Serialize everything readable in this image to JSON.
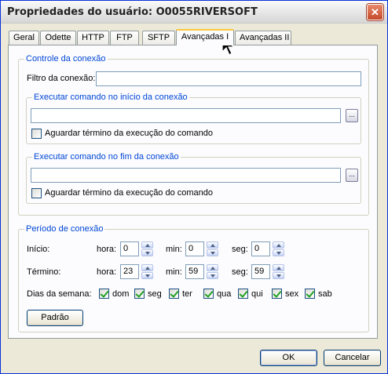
{
  "window": {
    "title": "Propriedades do usuário: O0055RIVERSOFT",
    "close_label": "✕"
  },
  "tabs": [
    {
      "label": "Geral"
    },
    {
      "label": "Odette"
    },
    {
      "label": "HTTP"
    },
    {
      "label": "FTP"
    },
    {
      "label": "SFTP"
    },
    {
      "label": "Avançadas I",
      "active": true
    },
    {
      "label": "Avançadas II"
    }
  ],
  "connection_control": {
    "legend": "Controle da conexão",
    "filter_label": "Filtro da conexão:",
    "filter_value": "",
    "start_group": {
      "legend": "Executar comando no início da conexão",
      "command_value": "",
      "browse_label": "...",
      "wait_label": "Aguardar término da execução do comando",
      "wait_checked": false
    },
    "end_group": {
      "legend": "Executar comando no fim da conexão",
      "command_value": "",
      "browse_label": "...",
      "wait_label": "Aguardar término da execução do comando",
      "wait_checked": false
    }
  },
  "connection_period": {
    "legend": "Período de conexão",
    "start": {
      "label": "Início:",
      "hour_label": "hora:",
      "hour": "0",
      "min_label": "min:",
      "min": "0",
      "sec_label": "seg:",
      "sec": "0"
    },
    "end": {
      "label": "Término:",
      "hour_label": "hora:",
      "hour": "23",
      "min_label": "min:",
      "min": "59",
      "sec_label": "seg:",
      "sec": "59"
    },
    "weekdays_label": "Dias da semana:",
    "weekdays": [
      {
        "label": "dom",
        "checked": true
      },
      {
        "label": "seg",
        "checked": true
      },
      {
        "label": "ter",
        "checked": true
      },
      {
        "label": "qua",
        "checked": true
      },
      {
        "label": "qui",
        "checked": true
      },
      {
        "label": "sex",
        "checked": true
      },
      {
        "label": "sab",
        "checked": true
      }
    ],
    "default_button": "Padrão"
  },
  "footer": {
    "ok_label": "OK",
    "cancel_label": "Cancelar"
  },
  "icons": {
    "close": "close-icon",
    "cursor": "mouse-pointer-icon",
    "spin_up": "spin-up-icon",
    "spin_down": "spin-down-icon"
  }
}
